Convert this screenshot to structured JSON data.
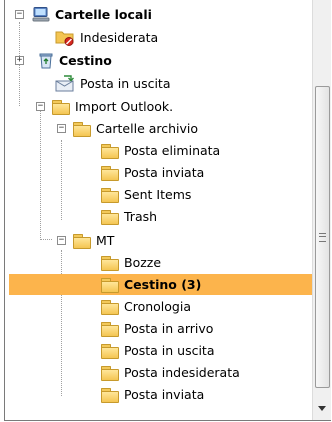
{
  "tree": {
    "items": [
      {
        "id": "cartelle-locali",
        "label": "Cartelle locali",
        "icon": "computer-icon",
        "toggle": "−"
      },
      {
        "id": "indesiderata",
        "label": "Indesiderata",
        "icon": "junk-folder-icon"
      },
      {
        "id": "cestino-root",
        "label": "Cestino",
        "icon": "recycle-bin-icon",
        "toggle": "+"
      },
      {
        "id": "posta-uscita-root",
        "label": "Posta in uscita",
        "icon": "outbox-icon"
      },
      {
        "id": "import-outlook",
        "label": "Import Outlook.",
        "icon": "folder-icon",
        "toggle": "−"
      },
      {
        "id": "cartelle-archivio",
        "label": "Cartelle archivio",
        "icon": "folder-icon",
        "toggle": "−"
      },
      {
        "id": "posta-eliminata",
        "label": "Posta eliminata",
        "icon": "folder-icon"
      },
      {
        "id": "posta-inviata-1",
        "label": "Posta inviata",
        "icon": "folder-icon"
      },
      {
        "id": "sent-items",
        "label": "Sent Items",
        "icon": "folder-icon"
      },
      {
        "id": "trash",
        "label": "Trash",
        "icon": "folder-icon"
      },
      {
        "id": "mt",
        "label": "MT",
        "icon": "folder-icon",
        "toggle": "−"
      },
      {
        "id": "bozze",
        "label": "Bozze",
        "icon": "folder-icon"
      },
      {
        "id": "cestino-mt",
        "label": "Cestino (3)",
        "icon": "folder-icon"
      },
      {
        "id": "cronologia",
        "label": "Cronologia",
        "icon": "folder-icon"
      },
      {
        "id": "posta-arrivo",
        "label": "Posta in arrivo",
        "icon": "folder-icon"
      },
      {
        "id": "posta-uscita-mt",
        "label": "Posta in uscita",
        "icon": "folder-icon"
      },
      {
        "id": "posta-indesiderata",
        "label": "Posta indesiderata",
        "icon": "folder-icon"
      },
      {
        "id": "posta-inviata-2",
        "label": "Posta inviata",
        "icon": "folder-icon"
      }
    ],
    "selected": "Cestino (3)"
  },
  "colors": {
    "selection": "#fcb44c",
    "folder": "#f4c552"
  },
  "scrollbar": {
    "grip_icon": "scroll-grip-icon",
    "down_icon": "scroll-down-arrow-icon"
  }
}
